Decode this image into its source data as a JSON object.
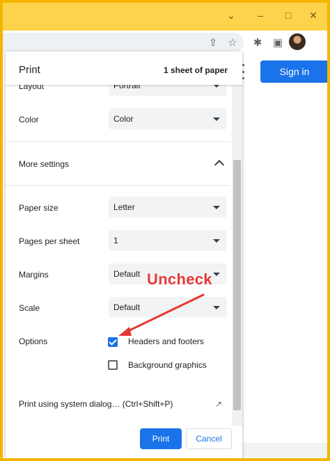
{
  "browser": {
    "window_controls": {
      "chevron": "⌄",
      "minimize": "–",
      "maximize": "□",
      "close": "✕"
    },
    "toolbar_icons": {
      "share": "⇪",
      "star": "☆",
      "extensions": "✱",
      "profile_panel": "▣"
    },
    "sign_in_label": "Sign in"
  },
  "dialog": {
    "title": "Print",
    "summary": "1 sheet of paper",
    "layout": {
      "label": "Layout",
      "value": "Portrait"
    },
    "color": {
      "label": "Color",
      "value": "Color"
    },
    "more_settings_label": "More settings",
    "paper_size": {
      "label": "Paper size",
      "value": "Letter"
    },
    "pages_per_sheet": {
      "label": "Pages per sheet",
      "value": "1"
    },
    "margins": {
      "label": "Margins",
      "value": "Default"
    },
    "scale": {
      "label": "Scale",
      "value": "Default"
    },
    "options": {
      "label": "Options",
      "headers_footers": {
        "label": "Headers and footers",
        "checked": true
      },
      "background_graphics": {
        "label": "Background graphics",
        "checked": false
      }
    },
    "system_dialog_label": "Print using system dialog… (Ctrl+Shift+P)",
    "print_button": "Print",
    "cancel_button": "Cancel"
  },
  "annotation": {
    "text": "Uncheck",
    "color": "#e53935"
  },
  "colors": {
    "accent": "#1a73e8",
    "frame": "#f5b400",
    "titlebar": "#fcd34a"
  }
}
